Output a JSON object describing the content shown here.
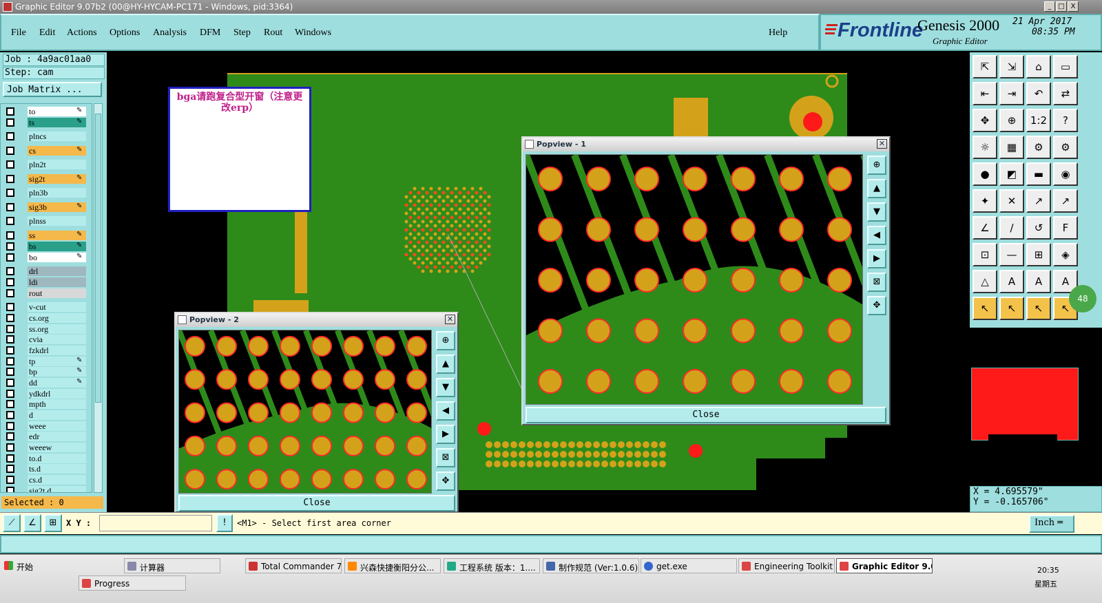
{
  "window": {
    "title": "Graphic Editor 9.07b2 (00@HY-HYCAM-PC171 - Windows, pid:3364)",
    "min": "_",
    "max": "□",
    "close": "X"
  },
  "menu": {
    "items": [
      "File",
      "Edit",
      "Actions",
      "Options",
      "Analysis",
      "DFM",
      "Step",
      "Rout",
      "Windows"
    ],
    "help": "Help"
  },
  "brand": {
    "logo": "Frontline",
    "product": "Genesis 2000",
    "subtitle": "Graphic Editor",
    "date": "21 Apr 2017",
    "time": "08:35 PM"
  },
  "job": {
    "job": "Job : 4a9ac01aa0",
    "step": "Step: cam",
    "matrix_btn": "Job Matrix ...",
    "selected": "Selected : 0"
  },
  "layers": [
    {
      "name": "to",
      "color": "#ffffff",
      "mark": "✎"
    },
    {
      "name": "ts",
      "color": "#2aa08a",
      "mark": "✎"
    },
    {
      "name": "plncs",
      "color": "#b4ecec",
      "mark": ""
    },
    {
      "name": "cs",
      "color": "#f5b84a",
      "mark": "✎"
    },
    {
      "name": "pln2t",
      "color": "#b4ecec",
      "mark": ""
    },
    {
      "name": "sig2t",
      "color": "#f5b84a",
      "mark": "✎"
    },
    {
      "name": "pln3b",
      "color": "#b4ecec",
      "mark": ""
    },
    {
      "name": "sig3b",
      "color": "#f5b84a",
      "mark": "✎"
    },
    {
      "name": "plnss",
      "color": "#b4ecec",
      "mark": ""
    },
    {
      "name": "ss",
      "color": "#f5b84a",
      "mark": "✎"
    },
    {
      "name": "bs",
      "color": "#2aa08a",
      "mark": "✎"
    },
    {
      "name": "bo",
      "color": "#ffffff",
      "mark": "✎"
    },
    {
      "name": "drl",
      "color": "#9fb8c0",
      "mark": ""
    },
    {
      "name": "ldi",
      "color": "#9fb8c0",
      "mark": ""
    },
    {
      "name": "rout",
      "color": "#d8d8d8",
      "mark": ""
    },
    {
      "name": "v-cut",
      "color": "#b4ecec",
      "mark": ""
    },
    {
      "name": "cs.org",
      "color": "#b4ecec",
      "mark": ""
    },
    {
      "name": "ss.org",
      "color": "#b4ecec",
      "mark": ""
    },
    {
      "name": "cvia",
      "color": "#b4ecec",
      "mark": ""
    },
    {
      "name": "fzkdrl",
      "color": "#b4ecec",
      "mark": ""
    },
    {
      "name": "tp",
      "color": "#b4ecec",
      "mark": "✎"
    },
    {
      "name": "bp",
      "color": "#b4ecec",
      "mark": "✎"
    },
    {
      "name": "dd",
      "color": "#b4ecec",
      "mark": "✎"
    },
    {
      "name": "ydkdrl",
      "color": "#b4ecec",
      "mark": ""
    },
    {
      "name": "mpth",
      "color": "#b4ecec",
      "mark": ""
    },
    {
      "name": "d",
      "color": "#b4ecec",
      "mark": ""
    },
    {
      "name": "weee",
      "color": "#b4ecec",
      "mark": ""
    },
    {
      "name": "edr",
      "color": "#b4ecec",
      "mark": ""
    },
    {
      "name": "weeew",
      "color": "#b4ecec",
      "mark": ""
    },
    {
      "name": "to.d",
      "color": "#b4ecec",
      "mark": ""
    },
    {
      "name": "ts.d",
      "color": "#b4ecec",
      "mark": ""
    },
    {
      "name": "cs.d",
      "color": "#b4ecec",
      "mark": ""
    },
    {
      "name": "sig2t.d",
      "color": "#b4ecec",
      "mark": ""
    }
  ],
  "note": {
    "text": "bga请跑复合型开窗（注意更改erp）"
  },
  "popview1": {
    "title": "Popview - 1",
    "close_label": "Close"
  },
  "popview2": {
    "title": "Popview - 2",
    "close_label": "Close"
  },
  "coords": {
    "x": "X = 4.695579\"",
    "y": "Y = -0.165706\"",
    "badge": "48"
  },
  "command": {
    "xy_label": "X Y :",
    "xy_value": "",
    "prompt": "<M1> - Select first area corner",
    "units": "Inch"
  },
  "taskbar": {
    "start": "开始",
    "tasks": [
      "计算器",
      "Total Commander 7.0...",
      "兴森快捷衡阳分公...",
      "工程系统  版本：1....",
      "制作规范 (Ver:1.0.6)",
      "get.exe",
      "Engineering Toolkit 9....",
      "Graphic Editor 9.07..."
    ],
    "progress": "Progress",
    "clock": "20:35",
    "day": "星期五"
  },
  "colors": {
    "board": "#2e8b1a",
    "pad": "#d4a21a",
    "pad_ring": "#ff2a2a",
    "panel": "#9fdede"
  }
}
